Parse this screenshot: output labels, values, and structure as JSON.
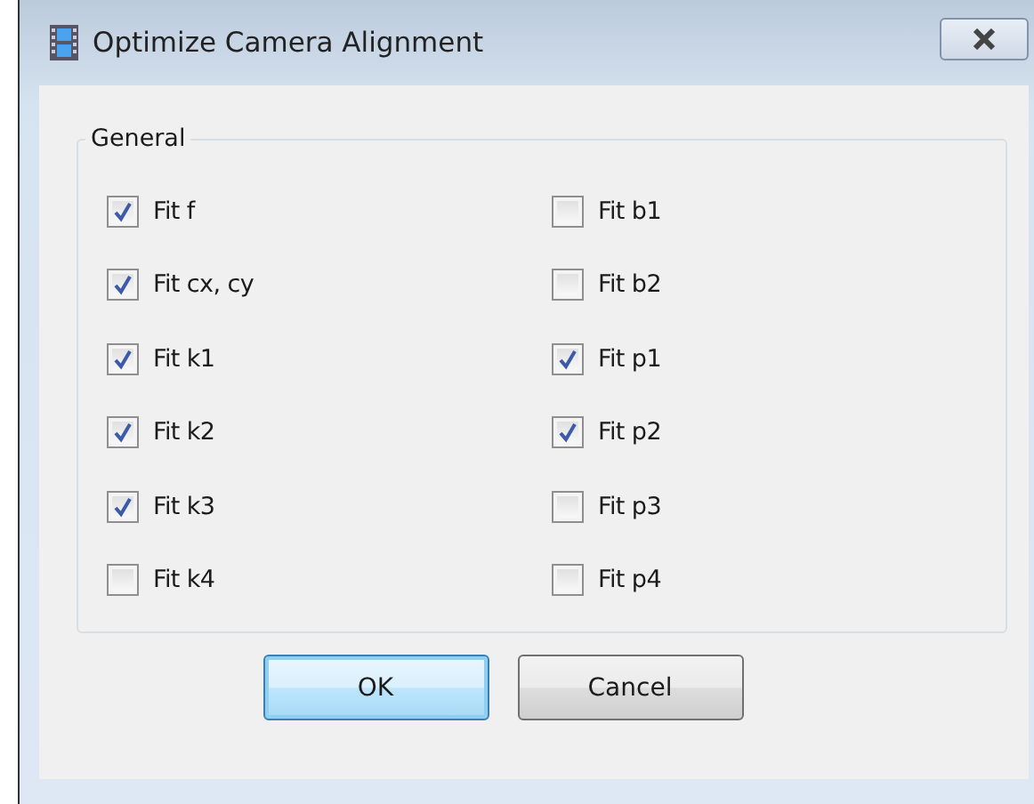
{
  "window": {
    "title": "Optimize Camera Alignment"
  },
  "group": {
    "title": "General",
    "left": [
      {
        "label": "Fit f",
        "checked": true
      },
      {
        "label": "Fit cx, cy",
        "checked": true
      },
      {
        "label": "Fit k1",
        "checked": true
      },
      {
        "label": "Fit k2",
        "checked": true
      },
      {
        "label": "Fit k3",
        "checked": true
      },
      {
        "label": "Fit k4",
        "checked": false
      }
    ],
    "right": [
      {
        "label": "Fit b1",
        "checked": false
      },
      {
        "label": "Fit b2",
        "checked": false
      },
      {
        "label": "Fit p1",
        "checked": true
      },
      {
        "label": "Fit p2",
        "checked": true
      },
      {
        "label": "Fit p3",
        "checked": false
      },
      {
        "label": "Fit p4",
        "checked": false
      }
    ]
  },
  "buttons": [
    {
      "label": "OK",
      "default": true
    },
    {
      "label": "Cancel",
      "default": false
    }
  ]
}
